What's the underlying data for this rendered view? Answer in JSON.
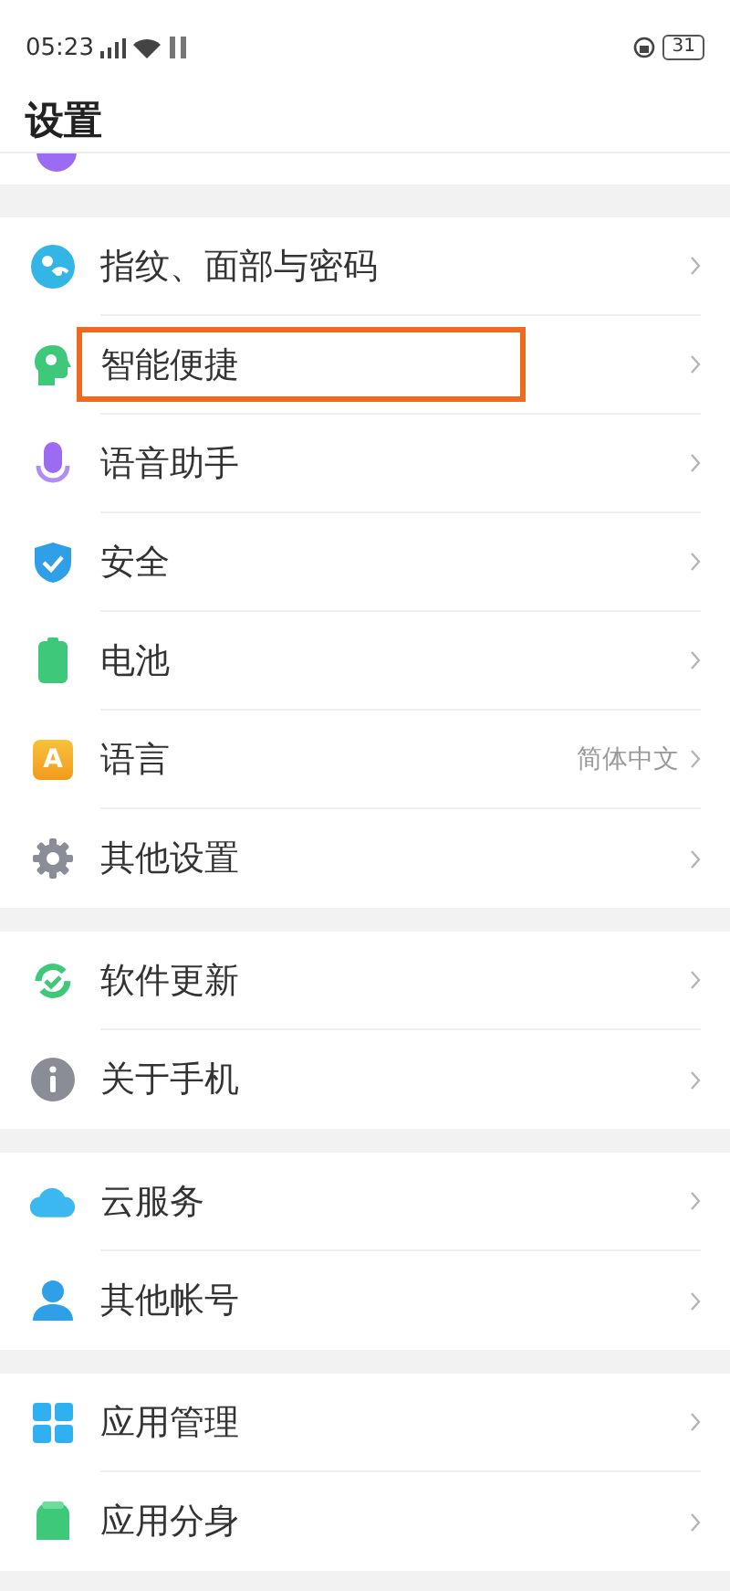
{
  "status_bar": {
    "time": "05:23",
    "battery": "31"
  },
  "title": "设置",
  "groups": [
    {
      "items": [
        {
          "label": "指纹、面部与密码",
          "highlighted": false
        },
        {
          "label": "智能便捷",
          "highlighted": true
        },
        {
          "label": "语音助手",
          "highlighted": false
        },
        {
          "label": "安全",
          "highlighted": false
        },
        {
          "label": "电池",
          "highlighted": false
        },
        {
          "label": "语言",
          "value": "简体中文",
          "icon_text": "A",
          "highlighted": false
        },
        {
          "label": "其他设置",
          "highlighted": false
        }
      ]
    },
    {
      "items": [
        {
          "label": "软件更新",
          "highlighted": false
        },
        {
          "label": "关于手机",
          "highlighted": false
        }
      ]
    },
    {
      "items": [
        {
          "label": "云服务",
          "highlighted": false
        },
        {
          "label": "其他帐号",
          "highlighted": false
        }
      ]
    },
    {
      "items": [
        {
          "label": "应用管理",
          "highlighted": false
        },
        {
          "label": "应用分身",
          "highlighted": false
        }
      ]
    }
  ]
}
